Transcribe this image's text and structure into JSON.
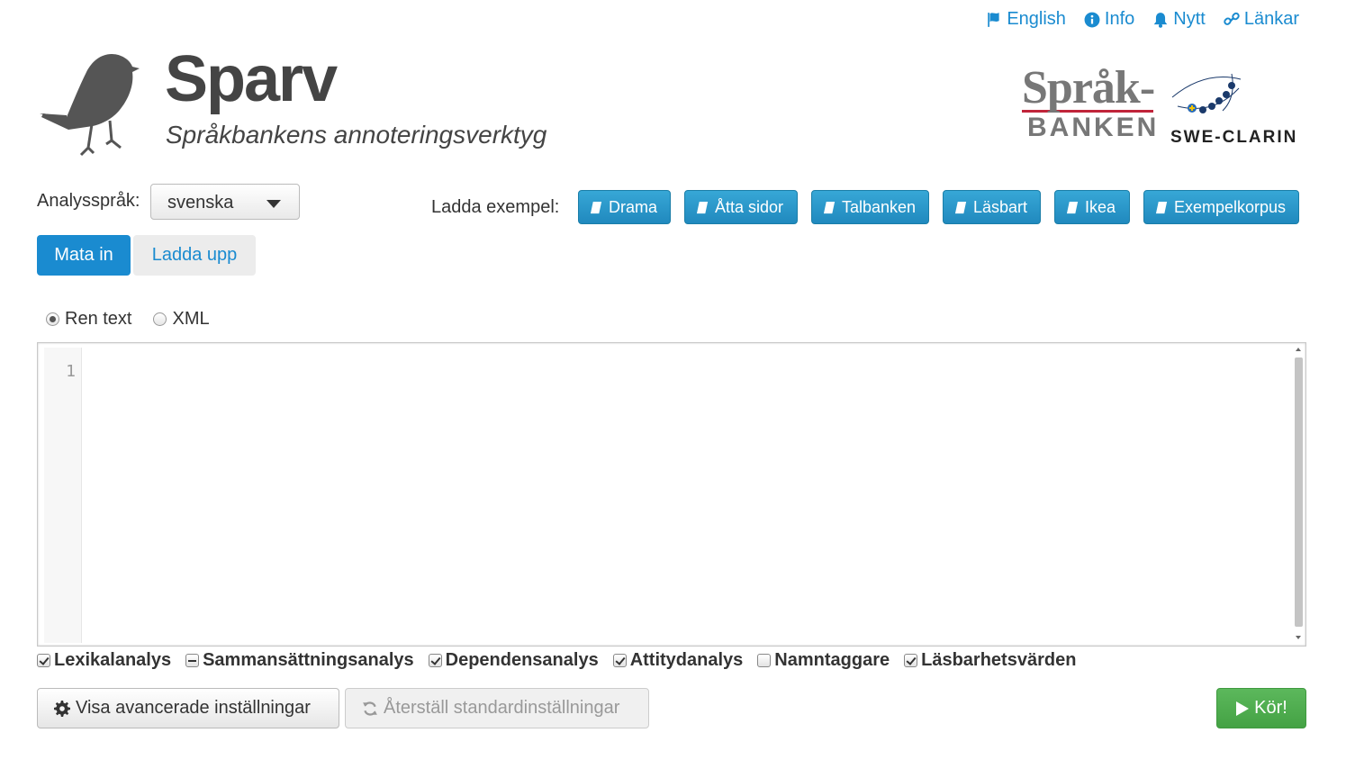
{
  "nav": {
    "english": "English",
    "info": "Info",
    "news": "Nytt",
    "links": "Länkar"
  },
  "header": {
    "title": "Sparv",
    "subtitle": "Språkbankens annoteringsverktyg"
  },
  "logos": {
    "sprakbanken_line1": "Språk-",
    "sprakbanken_line2": "BANKEN",
    "sweclarin": "SWE-CLARIN"
  },
  "language": {
    "label": "Analysspråk:",
    "selected": "svenska"
  },
  "examples": {
    "label": "Ladda exempel:",
    "items": [
      "Drama",
      "Åtta sidor",
      "Talbanken",
      "Läsbart",
      "Ikea",
      "Exempelkorpus"
    ]
  },
  "tabs": {
    "input": "Mata in",
    "upload": "Ladda upp"
  },
  "format": {
    "plain": "Ren text",
    "xml": "XML",
    "selected": "Ren text"
  },
  "editor": {
    "line_number": "1",
    "content": ""
  },
  "analyses": [
    {
      "label": "Lexikalanalys",
      "state": "checked"
    },
    {
      "label": "Sammansättningsanalys",
      "state": "mixed"
    },
    {
      "label": "Dependensanalys",
      "state": "checked"
    },
    {
      "label": "Attitydanalys",
      "state": "checked"
    },
    {
      "label": "Namntaggare",
      "state": "unchecked"
    },
    {
      "label": "Läsbarhetsvärden",
      "state": "checked"
    }
  ],
  "buttons": {
    "advanced": "Visa avancerade inställningar",
    "reset": "Återställ standardinställningar",
    "run": "Kör!"
  },
  "colors": {
    "link": "#1a8bd0",
    "example_button": "#2a97c9",
    "run_button": "#4cae4c",
    "active_tab": "#1a8bd0"
  }
}
